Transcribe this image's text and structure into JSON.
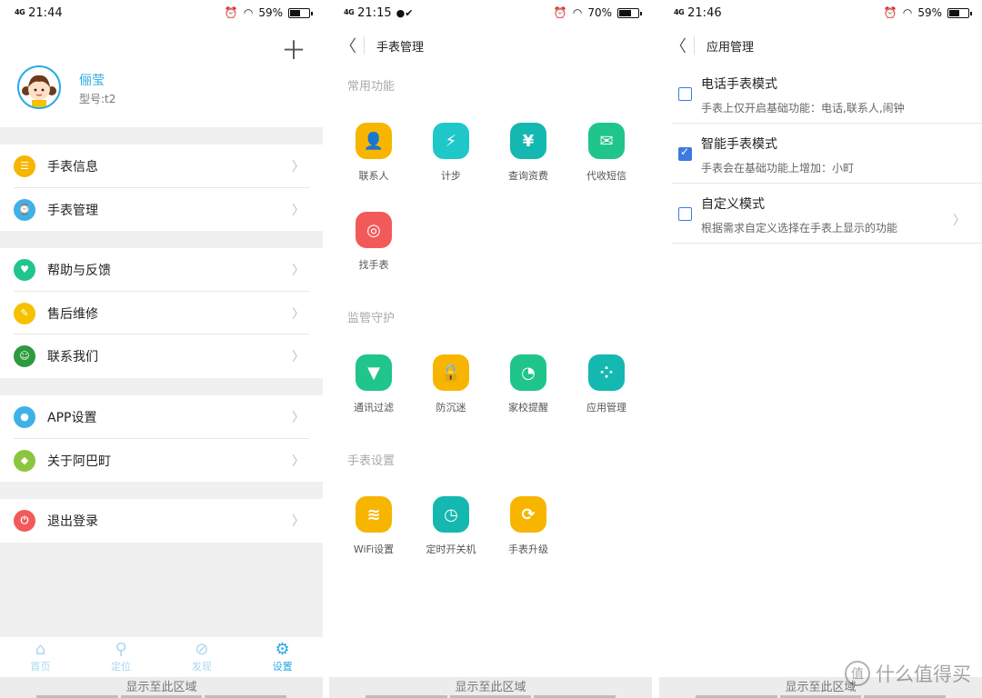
{
  "screen1": {
    "status": {
      "signal": "4G",
      "time": "21:44",
      "battery": "59%",
      "battery_pct": 59
    },
    "add_icon": "plus-icon",
    "user": {
      "name": "俪莹",
      "model": "型号:t2"
    },
    "menu": [
      {
        "label": "手表信息",
        "color": "#f7b500",
        "icon": "watch-info-icon"
      },
      {
        "label": "手表管理",
        "color": "#3fb1e8",
        "icon": "watch-manage-icon"
      },
      {
        "label": "帮助与反馈",
        "color": "#1fc58a",
        "icon": "help-icon"
      },
      {
        "label": "售后维修",
        "color": "#f7c100",
        "icon": "repair-icon"
      },
      {
        "label": "联系我们",
        "color": "#2e9a3e",
        "icon": "contact-icon"
      },
      {
        "label": "APP设置",
        "color": "#3fb1e8",
        "icon": "app-settings-icon"
      },
      {
        "label": "关于阿巴町",
        "color": "#8cc63f",
        "icon": "about-icon"
      },
      {
        "label": "退出登录",
        "color": "#f25a5a",
        "icon": "logout-icon"
      }
    ],
    "tabs": [
      {
        "label": "首页",
        "icon": "home-icon"
      },
      {
        "label": "定位",
        "icon": "location-icon"
      },
      {
        "label": "发现",
        "icon": "compass-icon"
      },
      {
        "label": "设置",
        "icon": "gear-icon"
      }
    ],
    "bottom_text": "显示至此区域"
  },
  "screen2": {
    "status": {
      "signal": "4G",
      "time": "21:15",
      "battery": "70%",
      "battery_pct": 70
    },
    "title": "手表管理",
    "sections": [
      {
        "title": "常用功能",
        "items": [
          {
            "label": "联系人",
            "color": "#f7b500",
            "glyph": "👤"
          },
          {
            "label": "计步",
            "color": "#1fc8c8",
            "glyph": "⚡"
          },
          {
            "label": "查询资费",
            "color": "#15b8b0",
            "glyph": "¥"
          },
          {
            "label": "代收短信",
            "color": "#1fc58a",
            "glyph": "✉"
          },
          {
            "label": "找手表",
            "color": "#f25a5a",
            "glyph": "◎"
          }
        ]
      },
      {
        "title": "监管守护",
        "items": [
          {
            "label": "通讯过滤",
            "color": "#1fc58a",
            "glyph": "▼"
          },
          {
            "label": "防沉迷",
            "color": "#f7b500",
            "glyph": "🔒"
          },
          {
            "label": "家校提醒",
            "color": "#1fc58a",
            "glyph": "◔"
          },
          {
            "label": "应用管理",
            "color": "#15b8b0",
            "glyph": "⁘"
          }
        ]
      },
      {
        "title": "手表设置",
        "items": [
          {
            "label": "WiFi设置",
            "color": "#f7b500",
            "glyph": "≋"
          },
          {
            "label": "定时开关机",
            "color": "#15b8b0",
            "glyph": "◷"
          },
          {
            "label": "手表升级",
            "color": "#f7b500",
            "glyph": "⟳"
          }
        ]
      }
    ],
    "bottom_text": "显示至此区域"
  },
  "screen3": {
    "status": {
      "signal": "4G",
      "time": "21:46",
      "battery": "59%",
      "battery_pct": 59
    },
    "title": "应用管理",
    "modes": [
      {
        "title": "电话手表模式",
        "desc": "手表上仅开启基础功能：电话,联系人,闹钟",
        "checked": false
      },
      {
        "title": "智能手表模式",
        "desc": "手表会在基础功能上增加：小町",
        "checked": true
      },
      {
        "title": "自定义模式",
        "desc": "根据需求自定义选择在手表上显示的功能",
        "checked": false
      }
    ],
    "bottom_text": "显示至此区域",
    "watermark": "什么值得买",
    "watermark_logo": "值"
  }
}
